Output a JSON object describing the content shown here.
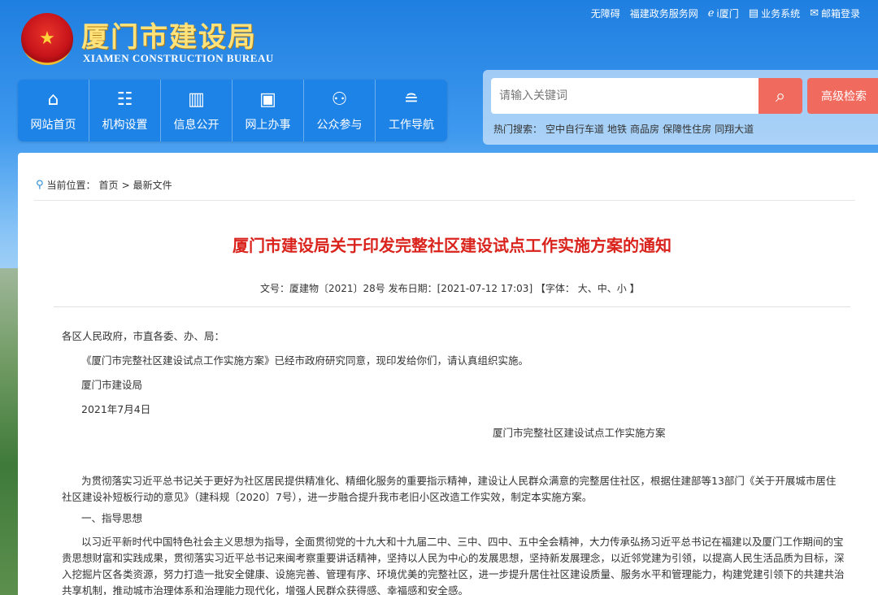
{
  "header": {
    "title": "厦门市建设局",
    "subtitle": "XIAMEN CONSTRUCTION BUREAU",
    "toplinks": [
      {
        "label": "无障碍",
        "icon": ""
      },
      {
        "label": "福建政务服务网",
        "icon": ""
      },
      {
        "label": "i厦门",
        "icon": "i-xiamen-icon"
      },
      {
        "label": "业务系统",
        "icon": "system-icon"
      },
      {
        "label": "邮箱登录",
        "icon": "mail-icon"
      }
    ]
  },
  "nav": {
    "items": [
      {
        "label": "网站首页",
        "icon": "home-icon"
      },
      {
        "label": "机构设置",
        "icon": "org-icon"
      },
      {
        "label": "信息公开",
        "icon": "info-icon"
      },
      {
        "label": "网上办事",
        "icon": "service-icon"
      },
      {
        "label": "公众参与",
        "icon": "people-icon"
      },
      {
        "label": "工作导航",
        "icon": "guide-icon"
      }
    ]
  },
  "search": {
    "placeholder": "请输入关键词",
    "advanced_label": "高级检索",
    "hot_label": "热门搜索：",
    "hot_words": [
      "空中自行车道",
      "地铁",
      "商品房",
      "保障性住房",
      "同翔大道"
    ]
  },
  "breadcrumb": {
    "prefix": "当前位置：",
    "items": [
      "首页",
      "最新文件"
    ],
    "separator": ">"
  },
  "article": {
    "title": "厦门市建设局关于印发完整社区建设试点工作实施方案的通知",
    "meta": "文号：厦建物〔2021〕28号 发布日期：[2021-07-12 17:03] 【字体： 大、中、小 】",
    "paragraphs": {
      "p1": "各区人民政府，市直各委、办、局：",
      "p2": "《厦门市完整社区建设试点工作实施方案》已经市政府研究同意，现印发给你们，请认真组织实施。",
      "p3": "厦门市建设局",
      "p4": "2021年7月4日",
      "p5": "厦门市完整社区建设试点工作实施方案",
      "p6": "为贯彻落实习近平总书记关于更好为社区居民提供精准化、精细化服务的重要指示精神，建设让人民群众满意的完整居住社区，根据住建部等13部门《关于开展城市居住社区建设补短板行动的意见》（建科规〔2020〕7号），进一步融合提升我市老旧小区改造工作实效，制定本实施方案。",
      "p7": "一、指导思想",
      "p8": "以习近平新时代中国特色社会主义思想为指导，全面贯彻党的十九大和十九届二中、三中、四中、五中全会精神，大力传承弘扬习近平总书记在福建以及厦门工作期间的宝贵思想财富和实践成果，贯彻落实习近平总书记来闽考察重要讲话精神，坚持以人民为中心的发展思想，坚持新发展理念，以近邻党建为引领，以提高人民生活品质为目标，深入挖掘片区各类资源，努力打造一批安全健康、设施完善、管理有序、环境优美的完整社区，进一步提升居住社区建设质量、服务水平和管理能力，构建党建引领下的共建共治共享机制，推动城市治理体系和治理能力现代化，增强人民群众获得感、幸福感和安全感。"
    }
  }
}
